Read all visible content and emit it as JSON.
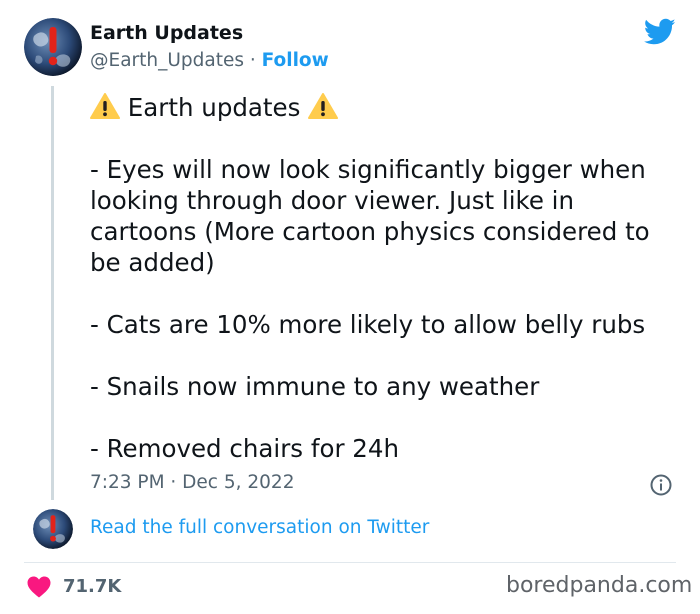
{
  "author": {
    "name": "Earth Updates",
    "handle": "@Earth_Updates",
    "separator": " · ",
    "follow_label": "Follow",
    "avatar_icon": "earth-warning-icon"
  },
  "tweet": {
    "title_text": "Earth updates",
    "title_icon": "warning-icon",
    "paragraphs": [
      "- Eyes will now look significantly bigger when looking through door viewer. Just like in cartoons (More cartoon physics considered to be added)",
      "- Cats are 10% more likely to allow belly rubs",
      "- Snails now immune to any weather",
      "- Removed chairs for 24h"
    ],
    "timestamp": "7:23 PM · Dec 5, 2022"
  },
  "conversation_link": "Read the full conversation on Twitter",
  "likes": {
    "count": "71.7K",
    "icon": "heart-icon"
  },
  "watermark": "boredpanda.com",
  "colors": {
    "accent": "#1d9bf0",
    "heart": "#f91880",
    "muted": "#536471",
    "warning": "#ffcc4d"
  }
}
